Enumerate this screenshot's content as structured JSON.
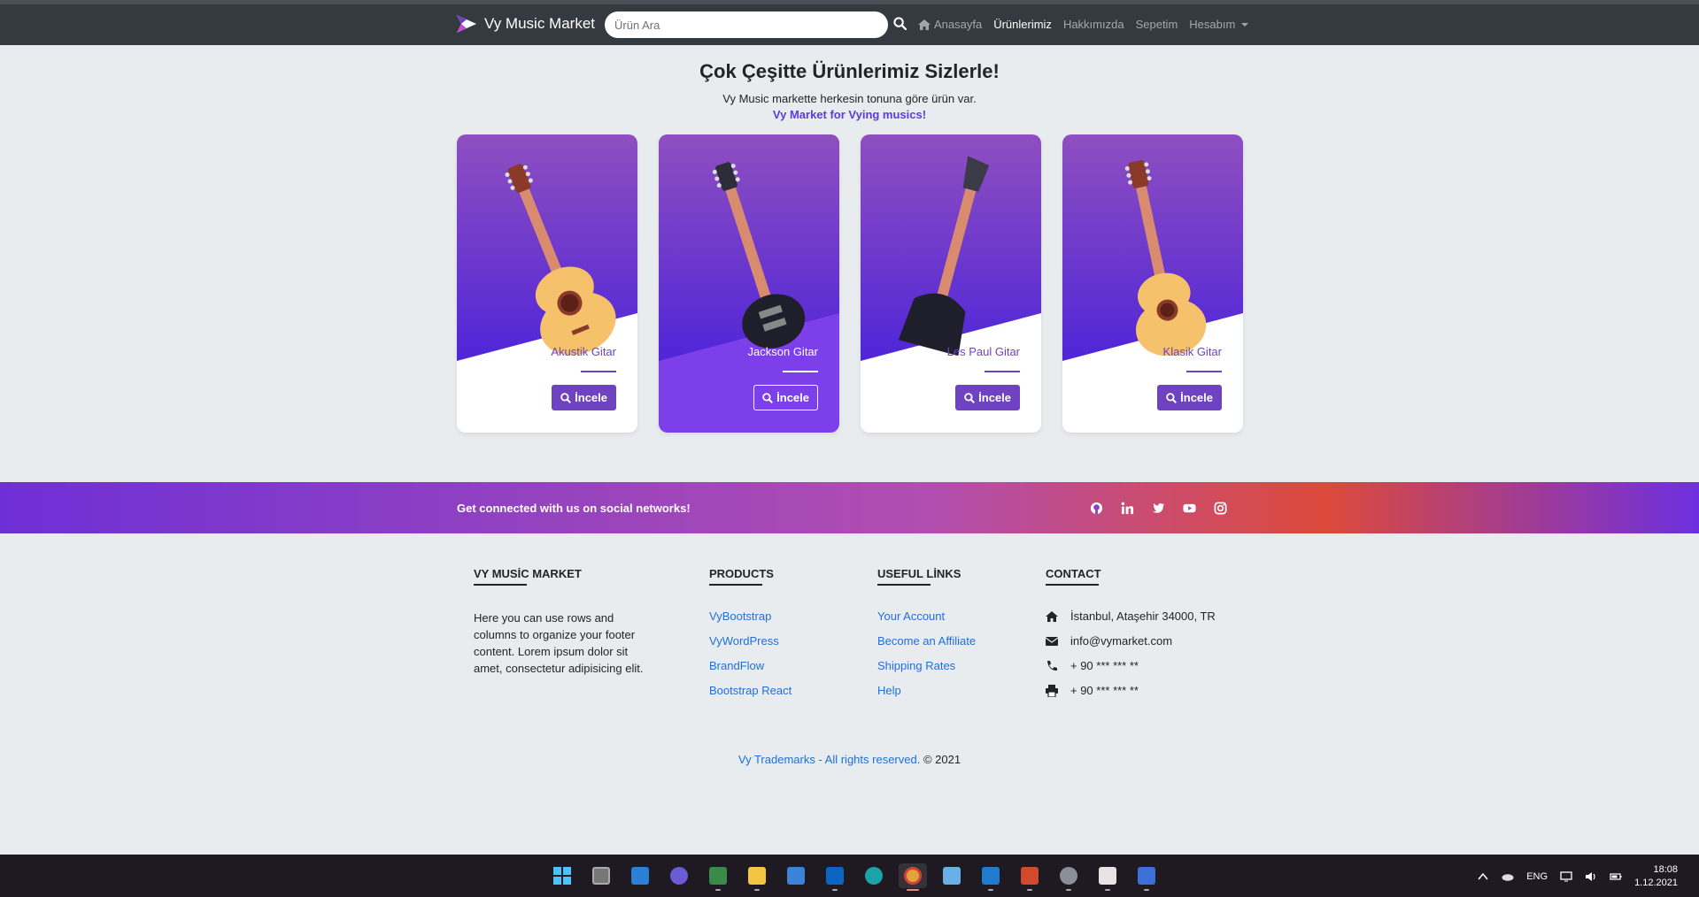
{
  "navbar": {
    "brand": "Vy Music Market",
    "search_placeholder": "Ürün Ara",
    "links": [
      {
        "label": "Anasayfa",
        "active": false
      },
      {
        "label": "Ürünlerimiz",
        "active": true
      },
      {
        "label": "Hakkımızda",
        "active": false
      },
      {
        "label": "Sepetim",
        "active": false
      },
      {
        "label": "Hesabım",
        "active": false
      }
    ]
  },
  "hero": {
    "title": "Çok Çeşitte Ürünlerimiz Sizlerle!",
    "subtitle": "Vy Music markette herkesin tonuna göre ürün var.",
    "tagline": "Vy Market for Vying musics!"
  },
  "products": [
    {
      "name": "Akustik Gitar",
      "button": "İncele"
    },
    {
      "name": "Jackson Gitar",
      "button": "İncele"
    },
    {
      "name": "Les Paul Gitar",
      "button": "İncele"
    },
    {
      "name": "Klasik Gitar",
      "button": "İncele"
    }
  ],
  "social": {
    "text": "Get connected with us on social networks!",
    "icons": [
      "github-icon",
      "linkedin-icon",
      "twitter-icon",
      "youtube-icon",
      "instagram-icon"
    ]
  },
  "footer": {
    "about": {
      "heading": "VY MUSİC MARKET",
      "text": "Here you can use rows and columns to organize your footer content. Lorem ipsum dolor sit amet, consectetur adipisicing elit."
    },
    "products": {
      "heading": "PRODUCTS",
      "links": [
        "VyBootstrap",
        "VyWordPress",
        "BrandFlow",
        "Bootstrap React"
      ]
    },
    "useful": {
      "heading": "USEFUL LİNKS",
      "links": [
        "Your Account",
        "Become an Affiliate",
        "Shipping Rates",
        "Help"
      ]
    },
    "contact": {
      "heading": "CONTACT",
      "address": "İstanbul, Ataşehir 34000, TR",
      "email": "info@vymarket.com",
      "phone": "+ 90 *** *** **",
      "fax": "+ 90 *** *** **"
    },
    "copyright_link": "Vy Trademarks - All rights reserved.",
    "copyright_year": "© 2021"
  },
  "taskbar": {
    "language": "ENG",
    "time": "18:08",
    "date": "1.12.2021"
  },
  "colors": {
    "accent": "#6f42c1",
    "navbar": "#343a40",
    "link": "#1e6fd9"
  }
}
